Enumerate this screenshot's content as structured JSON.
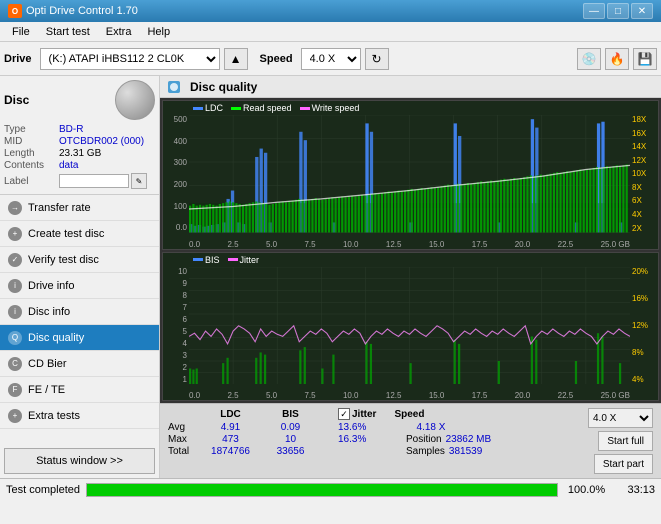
{
  "titleBar": {
    "title": "Opti Drive Control 1.70",
    "minBtn": "—",
    "maxBtn": "□",
    "closeBtn": "✕"
  },
  "menuBar": {
    "items": [
      "File",
      "Start test",
      "Extra",
      "Help"
    ]
  },
  "toolbar": {
    "driveLabel": "Drive",
    "driveValue": "(K:)  ATAPI iHBS112  2 CL0K",
    "speedLabel": "Speed",
    "speedValue": "4.0 X"
  },
  "disc": {
    "title": "Disc",
    "typeLabel": "Type",
    "typeValue": "BD-R",
    "midLabel": "MID",
    "midValue": "OTCBDR002 (000)",
    "lengthLabel": "Length",
    "lengthValue": "23.31 GB",
    "contentsLabel": "Contents",
    "contentsValue": "data",
    "labelLabel": "Label",
    "labelValue": ""
  },
  "nav": {
    "items": [
      {
        "id": "transfer-rate",
        "label": "Transfer rate"
      },
      {
        "id": "create-test-disc",
        "label": "Create test disc"
      },
      {
        "id": "verify-test-disc",
        "label": "Verify test disc"
      },
      {
        "id": "drive-info",
        "label": "Drive info"
      },
      {
        "id": "disc-info",
        "label": "Disc info"
      },
      {
        "id": "disc-quality",
        "label": "Disc quality",
        "active": true
      },
      {
        "id": "cd-bier",
        "label": "CD Bier"
      },
      {
        "id": "fe-te",
        "label": "FE / TE"
      },
      {
        "id": "extra-tests",
        "label": "Extra tests"
      }
    ],
    "statusWindowBtn": "Status window >>"
  },
  "contentHeader": {
    "title": "Disc quality"
  },
  "chart1": {
    "title": "LDC",
    "legend": [
      {
        "label": "LDC",
        "color": "#0099ff"
      },
      {
        "label": "Read speed",
        "color": "#00ff00"
      },
      {
        "label": "Write speed",
        "color": "#ff66ff"
      }
    ],
    "yAxisLeft": [
      "500",
      "400",
      "300",
      "200",
      "100",
      "0.0"
    ],
    "yAxisRight": [
      "18X",
      "16X",
      "14X",
      "12X",
      "10X",
      "8X",
      "6X",
      "4X",
      "2X"
    ],
    "xAxis": [
      "0.0",
      "2.5",
      "5.0",
      "7.5",
      "10.0",
      "12.5",
      "15.0",
      "17.5",
      "20.0",
      "22.5",
      "25.0 GB"
    ]
  },
  "chart2": {
    "legend": [
      {
        "label": "BIS",
        "color": "#0099ff"
      },
      {
        "label": "Jitter",
        "color": "#ff66ff"
      }
    ],
    "yAxisLeft": [
      "10",
      "9",
      "8",
      "7",
      "6",
      "5",
      "4",
      "3",
      "2",
      "1"
    ],
    "yAxisRight": [
      "20%",
      "16%",
      "12%",
      "8%",
      "4%"
    ],
    "xAxis": [
      "0.0",
      "2.5",
      "5.0",
      "7.5",
      "10.0",
      "12.5",
      "15.0",
      "17.5",
      "20.0",
      "22.5",
      "25.0 GB"
    ]
  },
  "stats": {
    "columns": [
      "LDC",
      "BIS",
      "",
      "Jitter",
      "Speed",
      "",
      ""
    ],
    "avgLabel": "Avg",
    "avgLDC": "4.91",
    "avgBIS": "0.09",
    "avgJitter": "13.6%",
    "avgSpeed": "4.18 X",
    "speedSelect": "4.0 X",
    "maxLabel": "Max",
    "maxLDC": "473",
    "maxBIS": "10",
    "maxJitter": "16.3%",
    "positionLabel": "Position",
    "positionValue": "23862 MB",
    "totalLabel": "Total",
    "totalLDC": "1874766",
    "totalBIS": "33656",
    "samplesLabel": "Samples",
    "samplesValue": "381539",
    "startFullBtn": "Start full",
    "startPartBtn": "Start part",
    "jitterLabel": "Jitter"
  },
  "statusBar": {
    "statusText": "Test completed",
    "progressPct": "100.0%",
    "time": "33:13"
  },
  "colors": {
    "accent": "#1e7dbf",
    "activeNav": "#1e7dbf",
    "chartBg": "#1c2a1c",
    "gridLine": "#2a3a2a",
    "ldcColor": "#0099ff",
    "readSpeedColor": "#00ff00",
    "writeSpeedColor": "#ff66ff",
    "bisColor": "#4488ff",
    "jitterColor": "#ff66ff",
    "valueBlue": "#0000cc"
  }
}
